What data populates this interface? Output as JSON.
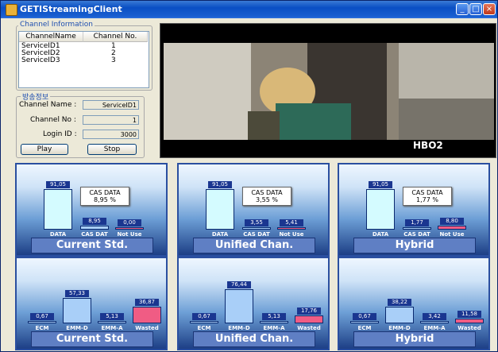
{
  "window": {
    "title": "GETIStreamingClient"
  },
  "channel_info": {
    "title": "Channel Information",
    "columns": [
      "ChannelName",
      "Channel No."
    ],
    "rows": [
      [
        "ServiceID1",
        "1"
      ],
      [
        "ServiceID2",
        "2"
      ],
      [
        "ServiceID3",
        "3"
      ]
    ]
  },
  "broadcast": {
    "title": "방송정보",
    "channel_name_label": "Channel Name :",
    "channel_name_value": "ServiceID1",
    "channel_no_label": "Channel No :",
    "channel_no_value": "1",
    "login_label": "Login ID :",
    "login_value": "3000",
    "play_label": "Play",
    "stop_label": "Stop"
  },
  "video": {
    "logo": "HBO2"
  },
  "colors": {
    "cyan_bar": "#d4fbff",
    "blue_bar": "#a9cff8",
    "pink_bar": "#f05c84"
  },
  "chart_data": [
    {
      "type": "bar",
      "panel": "top-left",
      "categories": [
        "DATA",
        "CAS DAT",
        "Not Use"
      ],
      "values": [
        91.05,
        8.95,
        0.0
      ],
      "value_labels": [
        "91,05",
        "8,95",
        "0,00"
      ],
      "callout": {
        "title": "CAS DATA",
        "value": "8,95 %"
      },
      "label": "Current Std."
    },
    {
      "type": "bar",
      "panel": "top-middle",
      "categories": [
        "DATA",
        "CAS DAT",
        "Not Use"
      ],
      "values": [
        91.05,
        3.55,
        5.41
      ],
      "value_labels": [
        "91,05",
        "3,55",
        "5,41"
      ],
      "callout": {
        "title": "CAS DATA",
        "value": "3,55 %"
      },
      "label": "Unified Chan."
    },
    {
      "type": "bar",
      "panel": "top-right",
      "categories": [
        "DATA",
        "CAS DAT",
        "Not Use"
      ],
      "values": [
        91.05,
        1.77,
        8.8
      ],
      "value_labels": [
        "91,05",
        "1,77",
        "8,80"
      ],
      "callout": {
        "title": "CAS DATA",
        "value": "1,77 %"
      },
      "label": "Hybrid"
    },
    {
      "type": "bar",
      "panel": "bottom-left",
      "categories": [
        "ECM",
        "EMM-D",
        "EMM-A",
        "Wasted"
      ],
      "values": [
        0.67,
        57.33,
        5.13,
        36.87
      ],
      "value_labels": [
        "0,67",
        "57,33",
        "5,13",
        "36,87"
      ],
      "label": "Current Std."
    },
    {
      "type": "bar",
      "panel": "bottom-middle",
      "categories": [
        "ECM",
        "EMM-D",
        "EMM-A",
        "Wasted"
      ],
      "values": [
        0.67,
        76.44,
        5.13,
        17.76
      ],
      "value_labels": [
        "0,67",
        "76,44",
        "5,13",
        "17,76"
      ],
      "label": "Unified Chan."
    },
    {
      "type": "bar",
      "panel": "bottom-right",
      "categories": [
        "ECM",
        "EMM-D",
        "EMM-A",
        "Wasted"
      ],
      "values": [
        0.67,
        38.22,
        3.42,
        11.58
      ],
      "value_labels": [
        "0,67",
        "38,22",
        "3,42",
        "11,58"
      ],
      "label": "Hybrid"
    }
  ]
}
